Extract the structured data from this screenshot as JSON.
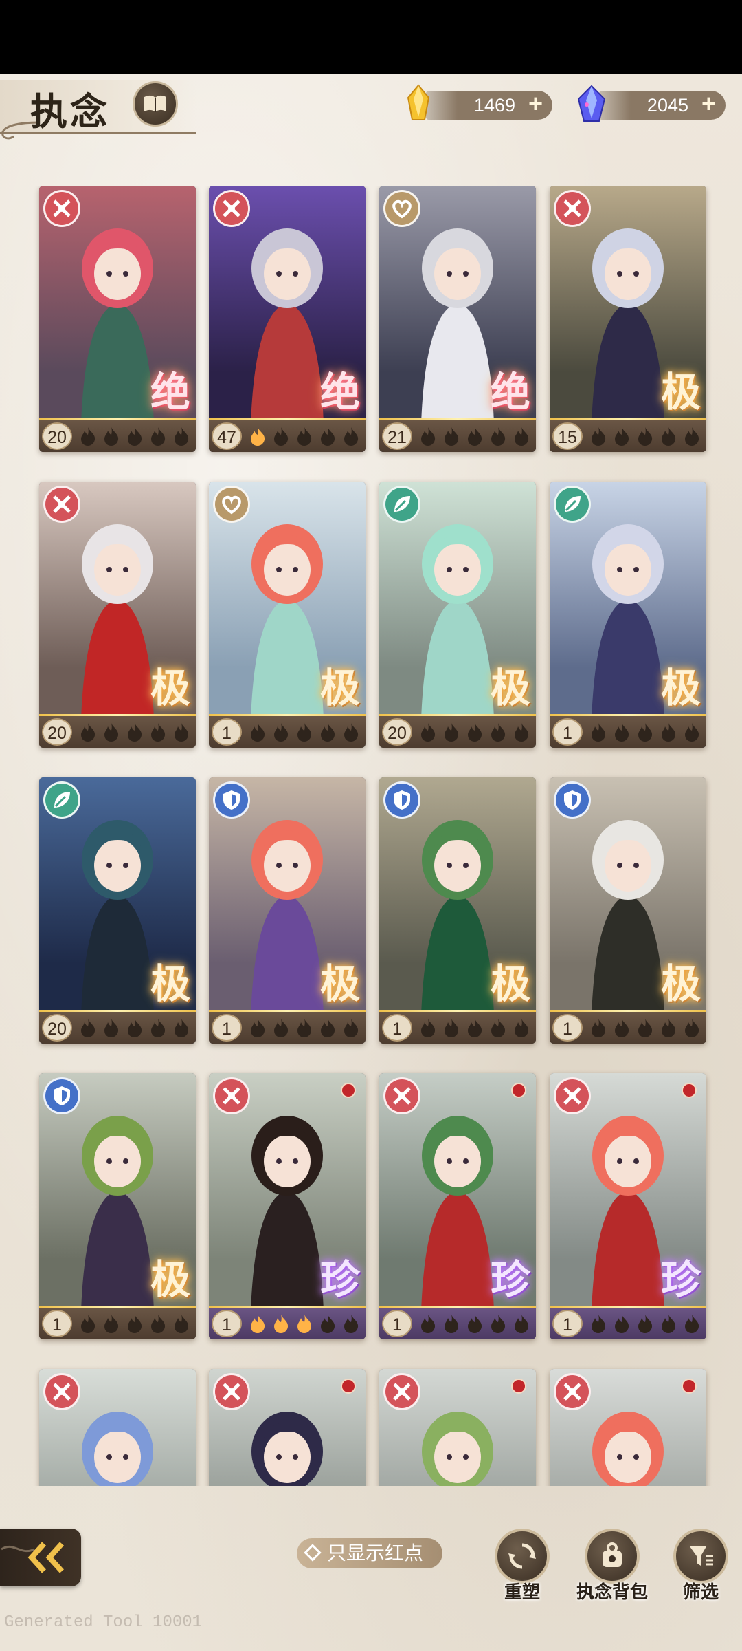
{
  "header": {
    "title": "执念",
    "currency_gold": {
      "icon": "gold-crystal-icon",
      "amount": "1469"
    },
    "currency_gem": {
      "icon": "blue-gem-icon",
      "amount": "2045"
    }
  },
  "colors": {
    "element_red": "#d4535a",
    "element_gold": "#b8996a",
    "element_green": "#3fa489",
    "element_blue": "#4470c8",
    "flame_lit": "#ffb347",
    "flame_dim": "#2e241c"
  },
  "cards": [
    {
      "element": "crossed-swords-icon",
      "rarity": "绝",
      "level": "20",
      "flames_lit": 0,
      "red_dot": false
    },
    {
      "element": "crossed-swords-icon",
      "rarity": "绝",
      "level": "47",
      "flames_lit": 1,
      "red_dot": false
    },
    {
      "element": "heart-icon",
      "rarity": "绝",
      "level": "21",
      "flames_lit": 0,
      "red_dot": false
    },
    {
      "element": "crossed-swords-icon",
      "rarity": "极",
      "level": "15",
      "flames_lit": 0,
      "red_dot": false
    },
    {
      "element": "crossed-swords-icon",
      "rarity": "极",
      "level": "20",
      "flames_lit": 0,
      "red_dot": false
    },
    {
      "element": "heart-icon",
      "rarity": "极",
      "level": "1",
      "flames_lit": 0,
      "red_dot": false
    },
    {
      "element": "leaf-icon",
      "rarity": "极",
      "level": "20",
      "flames_lit": 0,
      "red_dot": false
    },
    {
      "element": "leaf-icon",
      "rarity": "极",
      "level": "1",
      "flames_lit": 0,
      "red_dot": false
    },
    {
      "element": "leaf-icon",
      "rarity": "极",
      "level": "20",
      "flames_lit": 0,
      "red_dot": false
    },
    {
      "element": "shield-icon",
      "rarity": "极",
      "level": "1",
      "flames_lit": 0,
      "red_dot": false
    },
    {
      "element": "shield-icon",
      "rarity": "极",
      "level": "1",
      "flames_lit": 0,
      "red_dot": false
    },
    {
      "element": "shield-icon",
      "rarity": "极",
      "level": "1",
      "flames_lit": 0,
      "red_dot": false
    },
    {
      "element": "shield-icon",
      "rarity": "极",
      "level": "1",
      "flames_lit": 0,
      "red_dot": false
    },
    {
      "element": "crossed-swords-icon",
      "rarity": "珍",
      "level": "1",
      "flames_lit": 3,
      "red_dot": true
    },
    {
      "element": "crossed-swords-icon",
      "rarity": "珍",
      "level": "1",
      "flames_lit": 0,
      "red_dot": true
    },
    {
      "element": "crossed-swords-icon",
      "rarity": "珍",
      "level": "1",
      "flames_lit": 0,
      "red_dot": true
    },
    {
      "element": "crossed-swords-icon",
      "rarity": "",
      "level": "",
      "flames_lit": 0,
      "red_dot": false
    },
    {
      "element": "crossed-swords-icon",
      "rarity": "",
      "level": "",
      "flames_lit": 0,
      "red_dot": true
    },
    {
      "element": "crossed-swords-icon",
      "rarity": "",
      "level": "",
      "flames_lit": 0,
      "red_dot": true
    },
    {
      "element": "crossed-swords-icon",
      "rarity": "",
      "level": "",
      "flames_lit": 0,
      "red_dot": true
    }
  ],
  "bottom": {
    "back_icon": "double-chevron-left-icon",
    "red_dot_filter_label": "只显示红点",
    "rebuild_label": "重塑",
    "bag_label": "执念背包",
    "filter_label": "筛选"
  },
  "watermark": "Generated Tool 10001"
}
